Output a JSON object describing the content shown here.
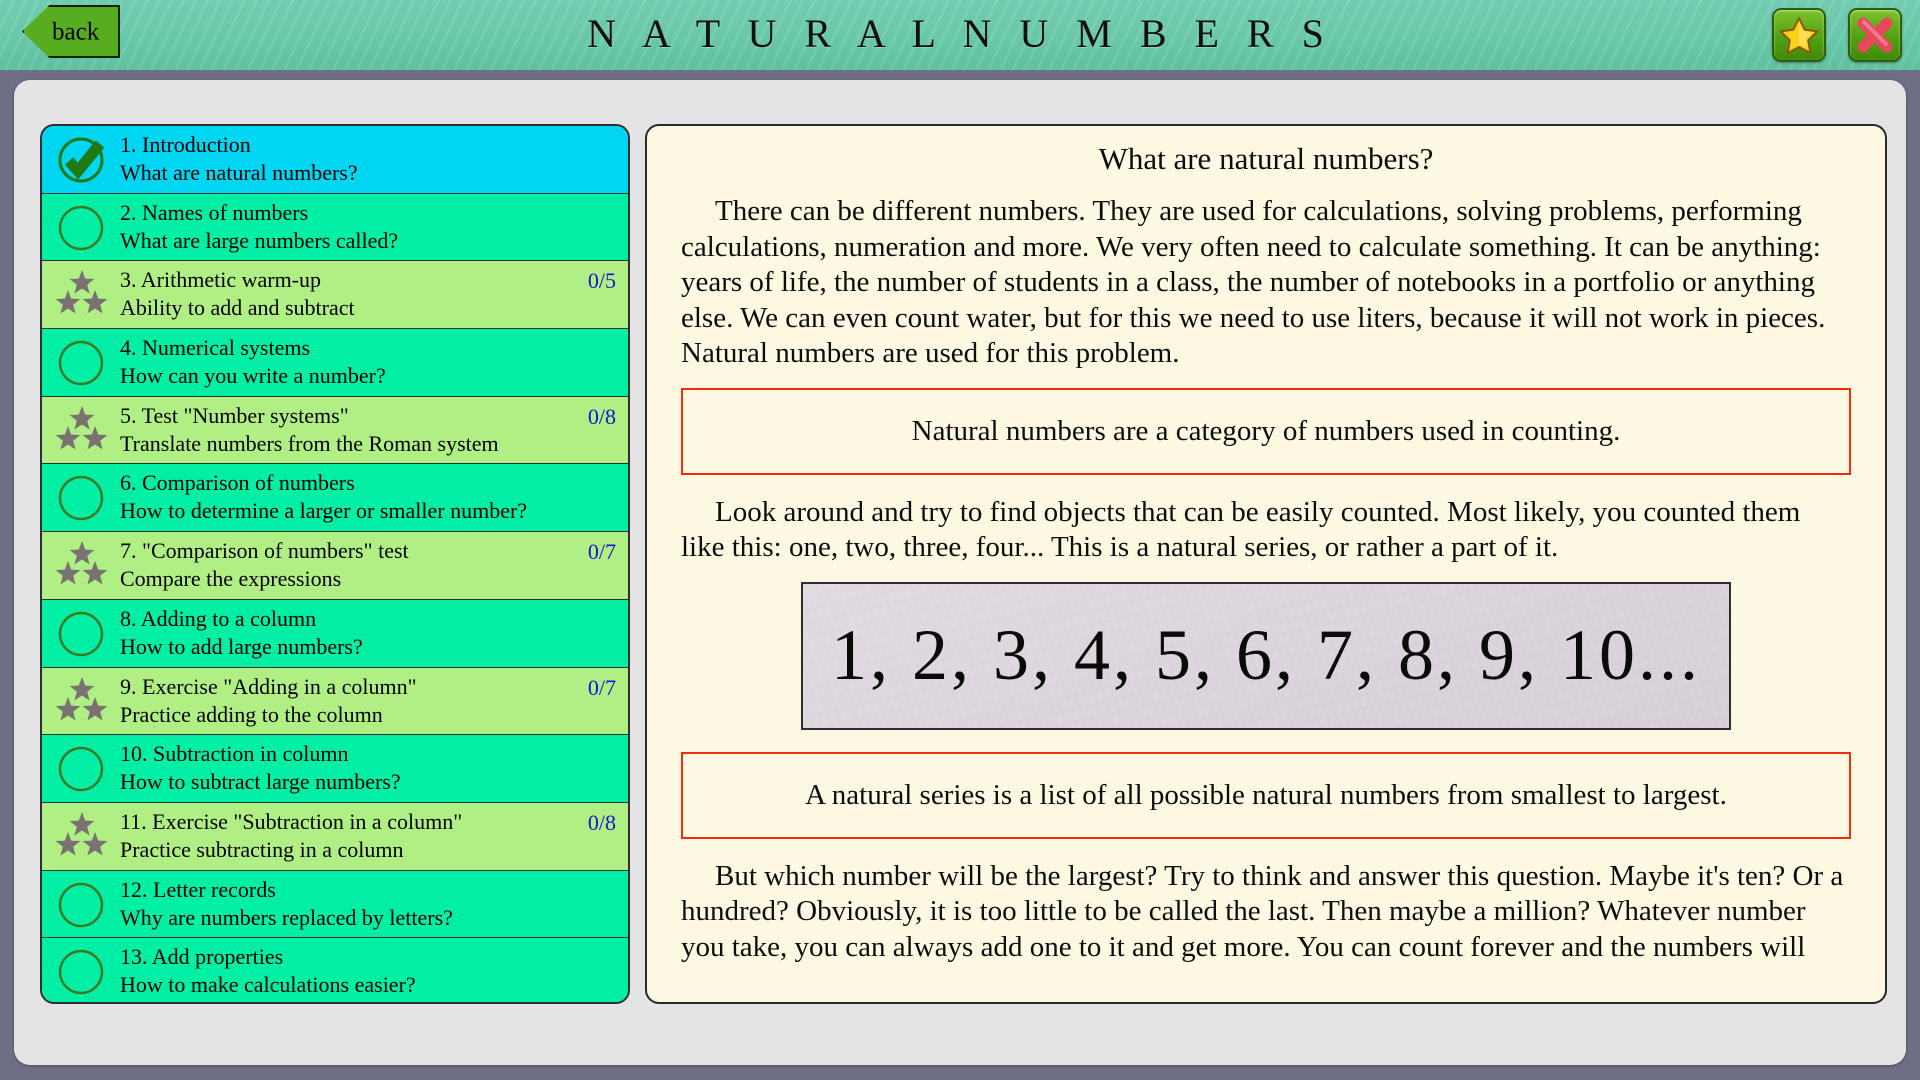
{
  "header": {
    "title": "N A T U R A L   N U M B E R S",
    "back_label": "back",
    "favorite_icon": "star-icon",
    "close_icon": "close-x-icon",
    "bg_color": "#6ccbad"
  },
  "sidebar": {
    "items": [
      {
        "num": "1.",
        "title": "1. Introduction",
        "subtitle": "What are natural numbers?",
        "type": "selected",
        "icon": "check-circle-icon",
        "score": ""
      },
      {
        "num": "2.",
        "title": "2. Names of numbers",
        "subtitle": "What are large numbers called?",
        "type": "lesson",
        "icon": "empty-circle-icon",
        "score": ""
      },
      {
        "num": "3.",
        "title": "3. Arithmetic warm-up",
        "subtitle": "Ability to add and subtract",
        "type": "test",
        "icon": "three-stars-icon",
        "score": "0/5"
      },
      {
        "num": "4.",
        "title": "4. Numerical systems",
        "subtitle": "How can you write a number?",
        "type": "lesson",
        "icon": "empty-circle-icon",
        "score": ""
      },
      {
        "num": "5.",
        "title": "5. Test \"Number systems\"",
        "subtitle": "Translate numbers from the Roman system",
        "type": "test",
        "icon": "three-stars-icon",
        "score": "0/8"
      },
      {
        "num": "6.",
        "title": "6. Comparison of numbers",
        "subtitle": "How to determine a larger or smaller number?",
        "type": "lesson",
        "icon": "empty-circle-icon",
        "score": ""
      },
      {
        "num": "7.",
        "title": "7. \"Comparison of numbers\" test",
        "subtitle": "Compare the expressions",
        "type": "test",
        "icon": "three-stars-icon",
        "score": "0/7"
      },
      {
        "num": "8.",
        "title": "8. Adding to a column",
        "subtitle": "How to add large numbers?",
        "type": "lesson",
        "icon": "empty-circle-icon",
        "score": ""
      },
      {
        "num": "9.",
        "title": "9. Exercise \"Adding in a column\"",
        "subtitle": "Practice adding to the column",
        "type": "test",
        "icon": "three-stars-icon",
        "score": "0/7"
      },
      {
        "num": "10.",
        "title": "10. Subtraction in column",
        "subtitle": "How to subtract large numbers?",
        "type": "lesson",
        "icon": "empty-circle-icon",
        "score": ""
      },
      {
        "num": "11.",
        "title": "11. Exercise \"Subtraction in a column\"",
        "subtitle": "Practice subtracting in a column",
        "type": "test",
        "icon": "three-stars-icon",
        "score": "0/8"
      },
      {
        "num": "12.",
        "title": "12. Letter records",
        "subtitle": "Why are numbers replaced by letters?",
        "type": "lesson",
        "icon": "empty-circle-icon",
        "score": ""
      },
      {
        "num": "13.",
        "title": "13. Add properties",
        "subtitle": "How to make calculations easier?",
        "type": "lesson",
        "icon": "empty-circle-icon",
        "score": ""
      }
    ],
    "colors": {
      "selected": "#00d5f2",
      "lesson": "#00efa5",
      "test": "#b0ef84",
      "score_text": "#1616d2",
      "star": "#7a7272",
      "check": "#1f7a14"
    }
  },
  "content": {
    "heading": "What are natural numbers?",
    "paragraph_1": "There can be different numbers. They are used for calculations, solving problems, performing calculations, numeration and more. We very often need to calculate something. It can be anything: years of life, the number of students in a class, the number of notebooks in a portfolio or anything else. We can even count water, but for this we need to use liters, because it will not work in pieces. Natural numbers are used for this problem.",
    "definition_1": "Natural numbers are a category of numbers used in counting.",
    "paragraph_2": "Look around and try to find objects that can be easily counted. Most likely, you counted them like this: one, two, three, four... This is a natural series, or rather a part of it.",
    "number_series": "1, 2, 3, 4, 5, 6, 7, 8, 9, 10...",
    "definition_2": "A natural series is a list of all possible natural numbers from smallest to largest.",
    "paragraph_3": "But which number will be the largest? Try to think and answer this question. Maybe it's ten? Or a hundred? Obviously, it is too little to be called the last. Then maybe a million? Whatever number you take, you can always add one to it and get more. You can count forever and the numbers will",
    "definition_border_color": "#f42c0c",
    "bg_color": "#fdf8e2"
  }
}
